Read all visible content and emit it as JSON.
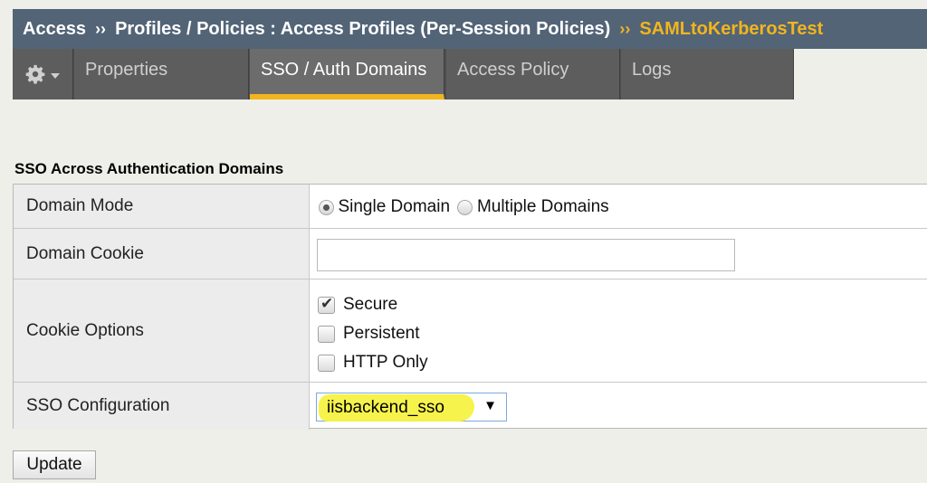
{
  "breadcrumb": {
    "root": "Access",
    "separator": "››",
    "path": "Profiles / Policies : Access Profiles (Per-Session Policies)",
    "current": "SAMLtoKerberosTest"
  },
  "tabs": [
    {
      "label": "Properties",
      "active": false
    },
    {
      "label": "SSO / Auth Domains",
      "active": true
    },
    {
      "label": "Access Policy",
      "active": false
    },
    {
      "label": "Logs",
      "active": false
    }
  ],
  "section": {
    "title": "SSO Across Authentication Domains"
  },
  "form": {
    "domain_mode": {
      "label": "Domain Mode",
      "options": [
        {
          "label": "Single Domain",
          "selected": true
        },
        {
          "label": "Multiple Domains",
          "selected": false
        }
      ]
    },
    "domain_cookie": {
      "label": "Domain Cookie",
      "value": ""
    },
    "cookie_options": {
      "label": "Cookie Options",
      "items": [
        {
          "label": "Secure",
          "checked": true
        },
        {
          "label": "Persistent",
          "checked": false
        },
        {
          "label": "HTTP Only",
          "checked": false
        }
      ]
    },
    "sso_configuration": {
      "label": "SSO Configuration",
      "selected": "iisbackend_sso"
    }
  },
  "actions": {
    "update_label": "Update"
  },
  "colors": {
    "header_bg": "#536477",
    "accent": "#f2b51d",
    "tab_bg": "#5d5d5d",
    "highlight": "#f5f242"
  }
}
